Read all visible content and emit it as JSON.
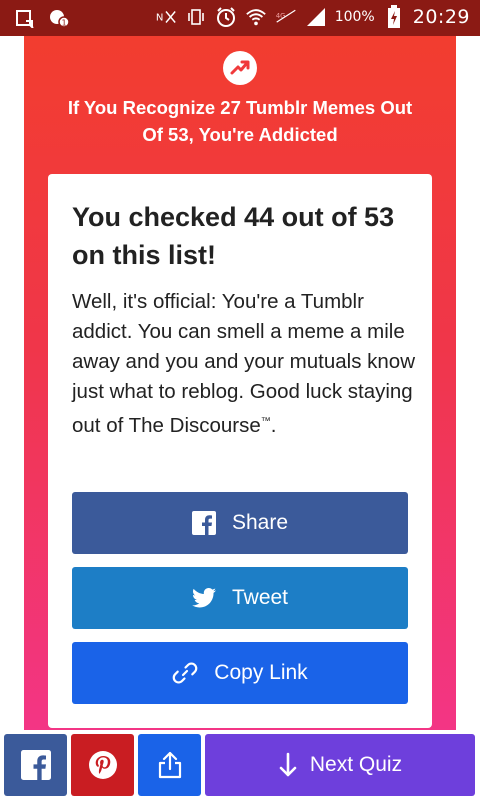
{
  "status_bar": {
    "battery_percent": "100%",
    "time": "20:29",
    "icons": [
      "screenshot-icon",
      "notification-icon",
      "nfc-icon",
      "vibrate-icon",
      "alarm-icon",
      "wifi-icon",
      "no-data-icon",
      "signal-icon",
      "battery-charging-icon"
    ]
  },
  "quiz": {
    "trend_icon": "trending-arrow-icon",
    "title_line1": "If You Recognize 27 Tumblr Memes Out",
    "title_line2": "Of 53, You're Addicted"
  },
  "result": {
    "heading": "You checked 44 out of 53 on this list!",
    "body": "Well, it's official: You're a Tumblr addict. You can smell a meme a mile away and you and your mutuals know just what to reblog. Good luck staying out of The Discourse",
    "trademark": "™",
    "body_end": "."
  },
  "share_buttons": {
    "facebook_label": "Share",
    "twitter_label": "Tweet",
    "copy_link_label": "Copy Link"
  },
  "bottom_bar": {
    "next_quiz_label": "Next Quiz"
  },
  "colors": {
    "facebook": "#3b5a9a",
    "twitter": "#1d7ec6",
    "copy_link": "#1a63e8",
    "pinterest": "#c91d22",
    "next_quiz": "#6e3fdc",
    "status_bar": "#8b1a14"
  }
}
